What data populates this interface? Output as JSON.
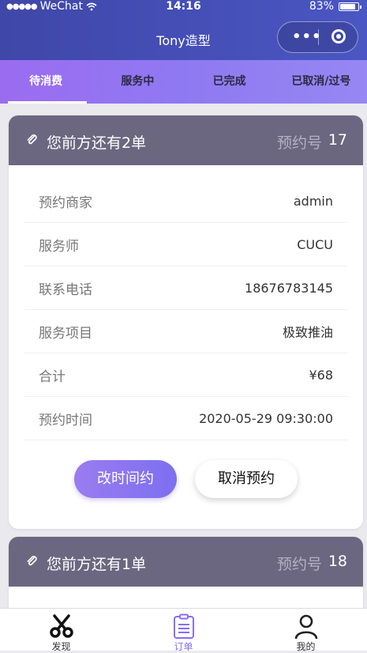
{
  "status_bar": {
    "carrier": "WeChat",
    "time": "14:16",
    "battery": "83%"
  },
  "header": {
    "title": "Tony造型"
  },
  "tabs": [
    {
      "label": "待消费",
      "active": true
    },
    {
      "label": "服务中",
      "active": false
    },
    {
      "label": "已完成",
      "active": false
    },
    {
      "label": "已取消/过号",
      "active": false
    }
  ],
  "cards": [
    {
      "queue_text": "您前方还有2单",
      "order_label": "预约号",
      "order_number": "17",
      "rows": [
        {
          "label": "预约商家",
          "value": "admin"
        },
        {
          "label": "服务师",
          "value": "CUCU"
        },
        {
          "label": "联系电话",
          "value": "18676783145"
        },
        {
          "label": "服务项目",
          "value": "极致推油"
        },
        {
          "label": "合计",
          "value": "¥68"
        },
        {
          "label": "预约时间",
          "value": "2020-05-29 09:30:00"
        }
      ],
      "actions": {
        "reschedule": "改时间约",
        "cancel": "取消预约"
      }
    },
    {
      "queue_text": "您前方还有1单",
      "order_label": "预约号",
      "order_number": "18"
    }
  ],
  "tabbar": [
    {
      "label": "发现",
      "icon": "scissors-icon"
    },
    {
      "label": "订单",
      "icon": "clipboard-icon",
      "active": true
    },
    {
      "label": "我的",
      "icon": "user-icon"
    }
  ],
  "colors": {
    "header": "#4a56c3",
    "accent": "#8a6ef0",
    "card_head": "#6c6780"
  }
}
